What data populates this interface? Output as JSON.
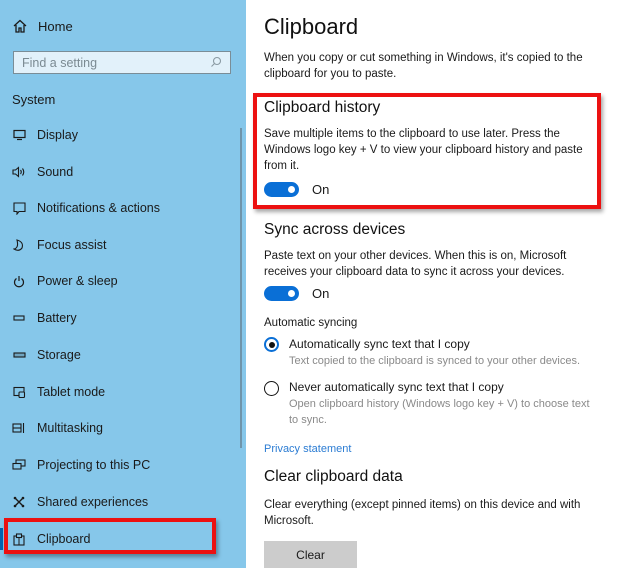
{
  "sidebar": {
    "home_label": "Home",
    "search_placeholder": "Find a setting",
    "section_label": "System",
    "items": [
      {
        "label": "Display",
        "icon": "display-icon"
      },
      {
        "label": "Sound",
        "icon": "sound-icon"
      },
      {
        "label": "Notifications & actions",
        "icon": "notifications-icon"
      },
      {
        "label": "Focus assist",
        "icon": "focus-assist-icon"
      },
      {
        "label": "Power & sleep",
        "icon": "power-icon"
      },
      {
        "label": "Battery",
        "icon": "battery-icon"
      },
      {
        "label": "Storage",
        "icon": "storage-icon"
      },
      {
        "label": "Tablet mode",
        "icon": "tablet-mode-icon"
      },
      {
        "label": "Multitasking",
        "icon": "multitasking-icon"
      },
      {
        "label": "Projecting to this PC",
        "icon": "projecting-icon"
      },
      {
        "label": "Shared experiences",
        "icon": "shared-experiences-icon"
      },
      {
        "label": "Clipboard",
        "icon": "clipboard-icon",
        "active": true
      }
    ]
  },
  "main": {
    "title": "Clipboard",
    "intro": "When you copy or cut something in Windows, it's copied to the clipboard for you to paste.",
    "history": {
      "heading": "Clipboard history",
      "description": "Save multiple items to the clipboard to use later. Press the Windows logo key + V to view your clipboard history and paste from it.",
      "toggle_state": "On"
    },
    "sync": {
      "heading": "Sync across devices",
      "description": "Paste text on your other devices. When this is on, Microsoft receives your clipboard data to sync it across your devices.",
      "toggle_state": "On",
      "auto_label": "Automatic syncing",
      "options": [
        {
          "label": "Automatically sync text that I copy",
          "description": "Text copied to the clipboard is synced to your other devices.",
          "selected": true
        },
        {
          "label": "Never automatically sync text that I copy",
          "description": "Open clipboard history (Windows logo key + V) to choose text to sync.",
          "selected": false
        }
      ]
    },
    "privacy_link": "Privacy statement",
    "clear": {
      "heading": "Clear clipboard data",
      "description": "Clear everything (except pinned items) on this device and with Microsoft.",
      "button_label": "Clear"
    }
  },
  "colors": {
    "sidebar_bg": "#86c7ea",
    "accent": "#0a6fd6",
    "highlight_border": "#ec1111",
    "link": "#2b7cd3"
  }
}
